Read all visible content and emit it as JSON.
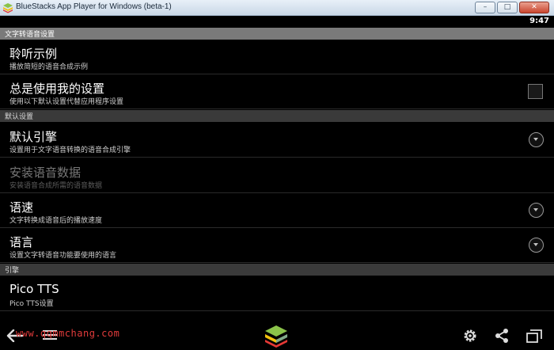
{
  "window": {
    "title": "BlueStacks App Player for Windows (beta-1)",
    "minimize": "–",
    "maximize": "□",
    "close": "✕"
  },
  "status": {
    "time": "9:47"
  },
  "header": {
    "title": "文字转语音设置"
  },
  "items": [
    {
      "title": "聆听示例",
      "subtitle": "播放简短的语音合成示例"
    },
    {
      "title": "总是使用我的设置",
      "subtitle": "使用以下默认设置代替应用程序设置"
    },
    {
      "title": "默认引擎",
      "subtitle": "设置用于文字语音转换的语音合成引擎"
    },
    {
      "title": "安装语音数据",
      "subtitle": "安装语音合成所需的语音数据"
    },
    {
      "title": "语速",
      "subtitle": "文字转换成语音后的播放速度"
    },
    {
      "title": "语言",
      "subtitle": "设置文字转语音功能要使用的语言"
    },
    {
      "title": "Pico TTS",
      "subtitle": "Pico TTS设置"
    }
  ],
  "sections": {
    "defaults": "默认设置",
    "engines": "引擎"
  },
  "watermark": "www.qqmmchang.com",
  "icons": {
    "back": "back-arrow-icon",
    "menu": "menu-icon",
    "logo": "bluestacks-logo-icon",
    "settings": "gear-icon",
    "share": "share-icon",
    "recent": "recent-apps-icon",
    "dropdown": "chevron-down-circle-icon",
    "checkbox": "checkbox-icon"
  },
  "colors": {
    "header_bg": "#7a7a7a",
    "section_bg": "#3a3a3a",
    "background": "#000000",
    "disabled_text": "#777777"
  }
}
